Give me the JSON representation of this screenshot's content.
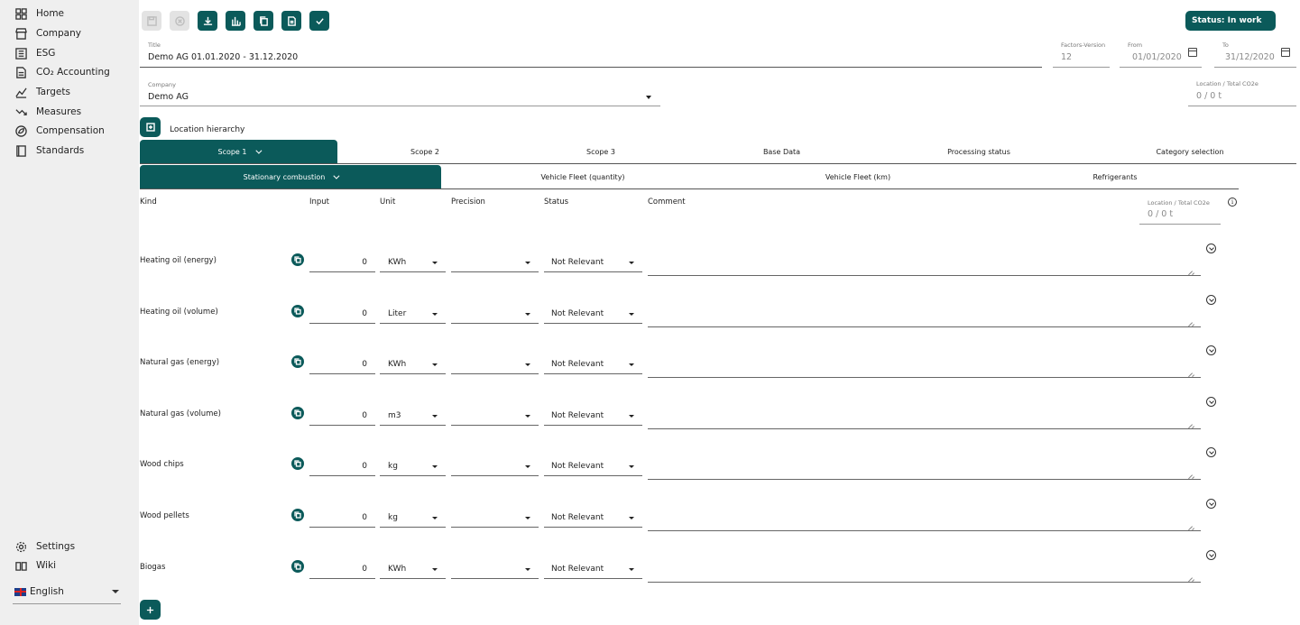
{
  "sidebar": {
    "items": [
      {
        "label": "Home",
        "icon": "grid-icon"
      },
      {
        "label": "Company",
        "icon": "store-icon"
      },
      {
        "label": "ESG",
        "icon": "list-icon"
      },
      {
        "label": "CO₂ Accounting",
        "icon": "document-icon"
      },
      {
        "label": "Targets",
        "icon": "chart-line-icon"
      },
      {
        "label": "Measures",
        "icon": "trend-down-icon"
      },
      {
        "label": "Compensation",
        "icon": "leaf-circle-icon"
      },
      {
        "label": "Standards",
        "icon": "book-icon"
      }
    ],
    "bottom_items": [
      {
        "label": "Settings",
        "icon": "gear-icon"
      },
      {
        "label": "Wiki",
        "icon": "open-book-icon"
      }
    ],
    "language": "English"
  },
  "toolbar": {
    "status_label": "Status: In work"
  },
  "header": {
    "title_label": "Title",
    "title_value": "Demo AG 01.01.2020 - 31.12.2020",
    "factors_label": "Factors-Version",
    "factors_value": "12",
    "from_label": "From",
    "from_value": "01/01/2020",
    "to_label": "To",
    "to_value": "31/12/2020",
    "company_label": "Company",
    "company_value": "Demo AG",
    "location_total_label": "Location / Total CO2e",
    "location_total_value": "0 / 0 t",
    "location_hierarchy": "Location hierarchy"
  },
  "scope_tabs": [
    "Scope 1",
    "Scope 2",
    "Scope 3",
    "Base Data",
    "Processing status",
    "Category selection"
  ],
  "sub_tabs": [
    "Stationary combustion",
    "Vehicle Fleet (quantity)",
    "Vehicle Fleet (km)",
    "Refrigerants"
  ],
  "table": {
    "headers": {
      "kind": "Kind",
      "input": "Input",
      "unit": "Unit",
      "precision": "Precision",
      "status": "Status",
      "comment": "Comment"
    },
    "location_total_label": "Location / Total CO2e",
    "location_total_value": "0 / 0 t",
    "rows": [
      {
        "kind": "Heating oil (energy)",
        "input": "0",
        "unit": "KWh",
        "precision": "",
        "status": "Not Relevant"
      },
      {
        "kind": "Heating oil (volume)",
        "input": "0",
        "unit": "Liter",
        "precision": "",
        "status": "Not Relevant"
      },
      {
        "kind": "Natural gas (energy)",
        "input": "0",
        "unit": "KWh",
        "precision": "",
        "status": "Not Relevant"
      },
      {
        "kind": "Natural gas (volume)",
        "input": "0",
        "unit": "m3",
        "precision": "",
        "status": "Not Relevant"
      },
      {
        "kind": "Wood chips",
        "input": "0",
        "unit": "kg",
        "precision": "",
        "status": "Not Relevant"
      },
      {
        "kind": "Wood pellets",
        "input": "0",
        "unit": "kg",
        "precision": "",
        "status": "Not Relevant"
      },
      {
        "kind": "Biogas",
        "input": "0",
        "unit": "KWh",
        "precision": "",
        "status": "Not Relevant"
      }
    ]
  },
  "colors": {
    "accent": "#0b5a5a",
    "sidebar_bg": "#efefef"
  }
}
